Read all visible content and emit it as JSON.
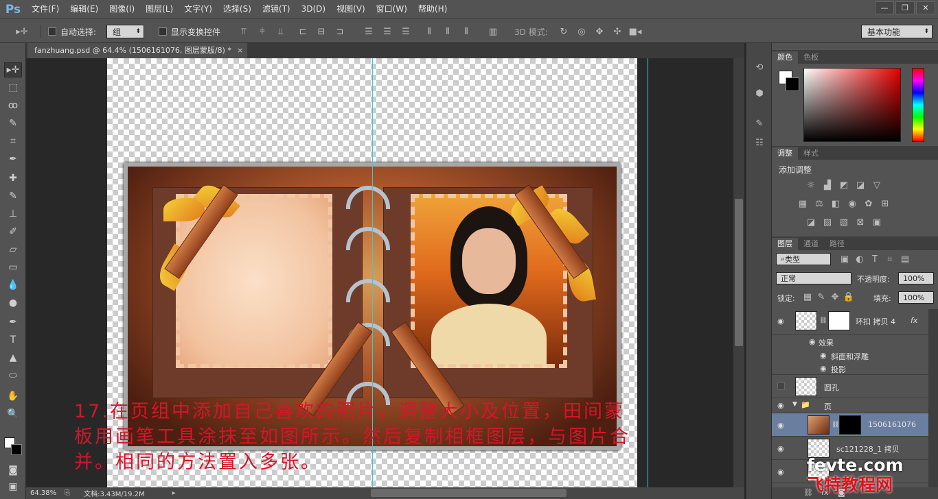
{
  "app": {
    "logo": "Ps"
  },
  "menu": [
    "文件(F)",
    "编辑(E)",
    "图像(I)",
    "图层(L)",
    "文字(Y)",
    "选择(S)",
    "滤镜(T)",
    "3D(D)",
    "视图(V)",
    "窗口(W)",
    "帮助(H)"
  ],
  "window_controls": [
    "—",
    "❐",
    "✕"
  ],
  "options": {
    "auto_select_label": "自动选择:",
    "auto_select_value": "组",
    "show_transform_label": "显示变换控件",
    "mode_3d_label": "3D 模式:",
    "workspace": "基本功能"
  },
  "document": {
    "tab_title": "fanzhuang.psd @ 64.4% (1506161076, 图层蒙版/8) *"
  },
  "canvas": {
    "caption": "17.在页组中添加自己喜欢的照片，调整大小及位置，田间蒙\n板用画笔工具涂抹至如图所示。然后复制相框图层，与图片合\n并。相同的方法置入多张。"
  },
  "status": {
    "zoom": "64.38%",
    "doc_info": "文档:3.43M/19.2M"
  },
  "panels": {
    "color_tabs": [
      "颜色",
      "色板"
    ],
    "adjust_tabs": [
      "调整",
      "样式"
    ],
    "adjust_title": "添加调整",
    "layers_tabs": [
      "图层",
      "通道",
      "路径"
    ],
    "filter_type": "类型",
    "blend_mode": "正常",
    "opacity_label": "不透明度:",
    "opacity_value": "100%",
    "lock_label": "锁定:",
    "fill_label": "填充:",
    "fill_value": "100%",
    "layers": [
      {
        "name": "环扣 拷贝 4",
        "fx": "fx"
      },
      {
        "name": "效果"
      },
      {
        "name": "斜面和浮雕"
      },
      {
        "name": "投影"
      },
      {
        "name": "圆孔"
      },
      {
        "name": "页"
      },
      {
        "name": "1506161076"
      },
      {
        "name": "sc121228_1 拷贝"
      },
      {
        "name": ""
      }
    ]
  },
  "watermark": {
    "line1": "fevte.com",
    "line2": "飞特教程网"
  },
  "colors": {
    "accent_guide": "#3ac8dc",
    "caption": "#d6152a",
    "selected_layer": "#6a7fa0"
  }
}
